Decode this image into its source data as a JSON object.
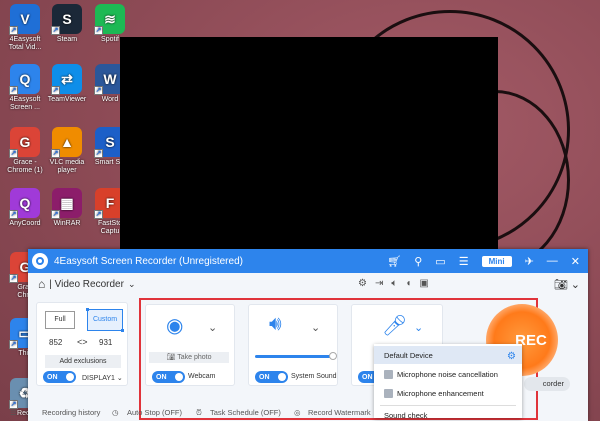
{
  "desktop": {
    "icons": [
      {
        "label": "4Easysoft\nTotal Vid...",
        "icon": "4easysoft-icon",
        "color": "#1f6fd6",
        "glyph": "V"
      },
      {
        "label": "Steam",
        "icon": "steam-icon",
        "color": "#1b2838",
        "glyph": "S"
      },
      {
        "label": "Spotif",
        "icon": "spotify-icon",
        "color": "#1db954",
        "glyph": "≋"
      },
      {
        "label": "4Easysoft\nScreen ...",
        "icon": "4easysoft-screen-icon",
        "color": "#2d84ec",
        "glyph": "Q"
      },
      {
        "label": "TeamViewer",
        "icon": "teamviewer-icon",
        "color": "#0e8ee9",
        "glyph": "⇄"
      },
      {
        "label": "Word",
        "icon": "word-icon",
        "color": "#2b579a",
        "glyph": "W"
      },
      {
        "label": "Grace -\nChrome (1)",
        "icon": "chrome-icon",
        "color": "#db4437",
        "glyph": "G"
      },
      {
        "label": "VLC media\nplayer",
        "icon": "vlc-icon",
        "color": "#f08c00",
        "glyph": "▲"
      },
      {
        "label": "Smart Sw",
        "icon": "smart-switch-icon",
        "color": "#1c5fc8",
        "glyph": "S"
      },
      {
        "label": "AnyCoord",
        "icon": "anycoord-icon",
        "color": "#a03ad8",
        "glyph": "Q"
      },
      {
        "label": "WinRAR",
        "icon": "winrar-icon",
        "color": "#8c1d6a",
        "glyph": "▦"
      },
      {
        "label": "FastSto\nCaptu",
        "icon": "faststone-icon",
        "color": "#d8402a",
        "glyph": "F"
      },
      {
        "label": "Grac\nChro",
        "icon": "chrome-icon",
        "color": "#db4437",
        "glyph": "G"
      },
      {
        "label": "This",
        "icon": "this-pc-icon",
        "color": "#2d84ec",
        "glyph": "▭"
      },
      {
        "label": "Recy",
        "icon": "recycle-bin-icon",
        "color": "#6a8fb0",
        "glyph": "♻"
      }
    ]
  },
  "app": {
    "title": "4Easysoft Screen Recorder (Unregistered)",
    "mini": "Mini",
    "mode": "| Video Recorder",
    "area": {
      "full": "Full",
      "custom": "Custom",
      "width": "852",
      "height": "931",
      "add_exclusions": "Add exclusions",
      "toggle": "ON",
      "display": "DISPLAY1"
    },
    "webcam": {
      "take_photo": "Take photo",
      "toggle": "ON",
      "label": "Webcam"
    },
    "sound": {
      "toggle": "ON",
      "label": "System Sound",
      "volume": 1.0
    },
    "mic": {
      "toggle": "ON"
    },
    "mic_menu": {
      "default_device": "Default Device",
      "noise": "Microphone noise cancellation",
      "enhancement": "Microphone enhancement",
      "sound_check": "Sound check"
    },
    "rec": "REC",
    "recorder": "corder",
    "footer": {
      "history": "Recording history",
      "auto_stop": "Auto Stop (OFF)",
      "task": "Task Schedule (OFF)",
      "watermark": "Record Watermark"
    },
    "colors": {
      "accent": "#2d84ec",
      "highlight": "#e0333a",
      "rec": "#ff7a1a"
    }
  }
}
